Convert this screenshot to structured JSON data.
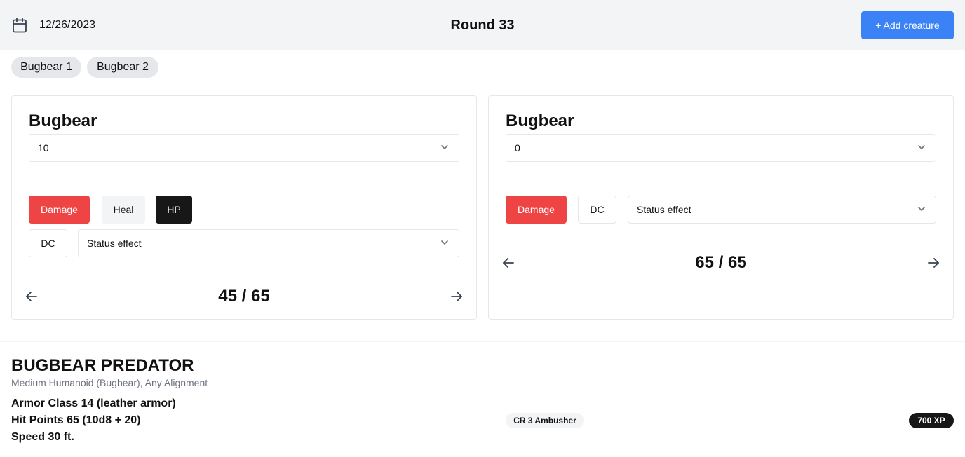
{
  "header": {
    "date": "12/26/2023",
    "calendar_icon": "calendar-icon",
    "round_label": "Round 33",
    "add_button_label": "+ Add creature"
  },
  "tabs": [
    {
      "label": "Bugbear 1"
    },
    {
      "label": "Bugbear 2"
    }
  ],
  "cards": [
    {
      "title": "Bugbear",
      "amount_value": "10",
      "damage_label": "Damage",
      "heal_label": "Heal",
      "hp_label": "HP",
      "dc_label": "DC",
      "status_placeholder": "Status effect",
      "hp_display": "45 / 65",
      "hp_current": 45,
      "hp_max": 65
    },
    {
      "title": "Bugbear",
      "amount_value": "0",
      "damage_label": "Damage",
      "dc_label": "DC",
      "status_placeholder": "Status effect",
      "hp_display": "65 / 65",
      "hp_current": 65,
      "hp_max": 65
    }
  ],
  "statblock": {
    "name": "BUGBEAR PREDATOR",
    "subtitle": "Medium Humanoid (Bugbear), Any Alignment",
    "armor_class": "Armor Class 14 (leather armor)",
    "hit_points": "Hit Points 65 (10d8 + 20)",
    "speed": "Speed 30 ft.",
    "cr_badge": "CR 3 Ambusher",
    "xp_badge": "700 XP"
  },
  "colors": {
    "accent": "#3b82f6",
    "damage": "#ef4444",
    "active": "#171717",
    "header_bg": "#f3f4f6"
  }
}
